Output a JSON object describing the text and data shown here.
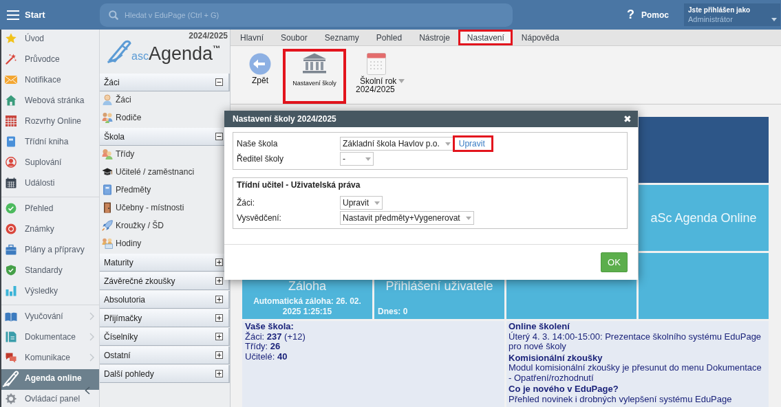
{
  "topbar": {
    "menu_label": "Start",
    "search": {
      "placeholder": "Hledat v EduPage (Ctrl + G)"
    },
    "help": {
      "icon": "?",
      "label": "Pomoc"
    },
    "user": {
      "caption": "Jste přihlášen jako",
      "name": "Administrátor"
    }
  },
  "sidebar": {
    "groups": [
      {
        "items": [
          {
            "label": "Úvod",
            "selected": false,
            "submenu": false
          },
          {
            "label": "Průvodce",
            "selected": false,
            "submenu": false
          },
          {
            "label": "Notifikace",
            "selected": false,
            "submenu": false
          },
          {
            "label": "Webová stránka",
            "selected": false,
            "submenu": false
          },
          {
            "label": "Rozvrhy Online",
            "selected": false,
            "submenu": false
          },
          {
            "label": "Třídní kniha",
            "selected": false,
            "submenu": false
          },
          {
            "label": "Suplování",
            "selected": false,
            "submenu": false
          },
          {
            "label": "Události",
            "selected": false,
            "submenu": false
          }
        ]
      },
      {
        "items": [
          {
            "label": "Přehled",
            "selected": false,
            "submenu": false
          },
          {
            "label": "Známky",
            "selected": false,
            "submenu": false
          },
          {
            "label": "Plány a přípravy",
            "selected": false,
            "submenu": false
          },
          {
            "label": "Standardy",
            "selected": false,
            "submenu": false
          },
          {
            "label": "Výsledky",
            "selected": false,
            "submenu": false
          }
        ]
      },
      {
        "items": [
          {
            "label": "Vyučování",
            "selected": false,
            "submenu": true
          },
          {
            "label": "Dokumentace",
            "selected": false,
            "submenu": true
          },
          {
            "label": "Komunikace",
            "selected": false,
            "submenu": true
          },
          {
            "label": "Agenda online",
            "selected": true,
            "submenu": false
          },
          {
            "label": "Ovládací panel",
            "selected": false,
            "submenu": false
          }
        ]
      }
    ]
  },
  "agenda_panel": {
    "year": "2024/2025",
    "logo": {
      "prefix": "asc",
      "name": "Agenda",
      "mark": "™"
    },
    "sections": [
      {
        "title": "Žáci",
        "expanded": true,
        "items": [
          "Žáci",
          "Rodiče"
        ]
      },
      {
        "title": "Škola",
        "expanded": true,
        "items": [
          "Třídy",
          "Učitelé / zaměstnanci",
          "Předměty",
          "Učebny - místnosti",
          "Kroužky / ŠD",
          "Hodiny"
        ]
      },
      {
        "title": "Maturity",
        "expanded": false
      },
      {
        "title": "Závěrečné zkoušky",
        "expanded": false
      },
      {
        "title": "Absolutoria",
        "expanded": false
      },
      {
        "title": "Přijímačky",
        "expanded": false
      },
      {
        "title": "Číselníky",
        "expanded": false
      },
      {
        "title": "Ostatní",
        "expanded": false
      },
      {
        "title": "Další pohledy",
        "expanded": false
      }
    ]
  },
  "menu_tabs": [
    {
      "label": "Hlavní",
      "selected": false,
      "highlighted": false
    },
    {
      "label": "Soubor",
      "selected": false,
      "highlighted": false
    },
    {
      "label": "Seznamy",
      "selected": false,
      "highlighted": false
    },
    {
      "label": "Pohled",
      "selected": false,
      "highlighted": false
    },
    {
      "label": "Nástroje",
      "selected": false,
      "highlighted": false
    },
    {
      "label": "Nastavení",
      "selected": true,
      "highlighted": true
    },
    {
      "label": "Nápověda",
      "selected": false,
      "highlighted": false
    }
  ],
  "ribbon": {
    "buttons": [
      {
        "kind": "back",
        "label": "Zpět",
        "highlighted": false,
        "dropdown": false
      },
      {
        "kind": "school",
        "label": "Nastavení školy",
        "highlighted": true,
        "dropdown": false
      },
      {
        "kind": "year",
        "label": "Školní rok",
        "detail": "2024/2025",
        "highlighted": false,
        "dropdown": true
      }
    ]
  },
  "dashboard": {
    "tile_rows": [
      {
        "tiles": [
          {
            "kind": "plain",
            "color": "#2d5688"
          }
        ]
      },
      {
        "tiles": [
          {
            "kind": "plain",
            "color": "#4fb5da",
            "title": "aSc Agenda Online"
          }
        ]
      },
      {
        "tiles": [
          {
            "kind": "note",
            "color": "#4fb5da",
            "title": "Záloha",
            "detail": "Automatická záloha: 26. 02. 2025 1:25:15"
          },
          {
            "kind": "count",
            "color": "#4fb5da",
            "title": "Přihlášení uživatele",
            "detail": "Dnes: 0"
          },
          {
            "kind": "plain",
            "color": "#4fb5da"
          },
          {
            "kind": "plain",
            "color": "#4fb5da"
          }
        ]
      }
    ],
    "school": {
      "title": "Vaše škola:",
      "lines": [
        "Žáci: **237** (+12)",
        "Třídy: **26**",
        "Učitelé: **40**"
      ]
    },
    "news": [
      {
        "title": "Online školení",
        "text": "Úterý 4. 3. 14:00-15:00: Prezentace školního systému EduPage pro nové školy"
      },
      {
        "title": "Komisionální zkoušky",
        "text": "Modul komisionální zkoušky je přesunut do menu Dokumentace - Opatření/rozhodnutí"
      },
      {
        "title": "Co je nového v EduPage?",
        "text": "Přehled novinek i drobných vylepšení systému EduPage"
      }
    ]
  },
  "dialog": {
    "title": "Nastavení školy 2024/2025",
    "close": "✖",
    "groups": [
      {
        "fields": [
          {
            "label": "Naše škola",
            "value": "Základní škola Havlov p.o.",
            "link": {
              "label": "Upravit",
              "highlighted": true
            }
          },
          {
            "label": "Ředitel školy",
            "value": "-"
          }
        ]
      },
      {
        "title": "Třídní učitel - Uživatelská práva",
        "fields": [
          {
            "label": "Žáci:",
            "value": "Upravit"
          },
          {
            "label": "Vysvědčení:",
            "value": "Nastavit předměty+Vygenerovat"
          }
        ]
      }
    ],
    "buttons": [
      "OK"
    ]
  }
}
